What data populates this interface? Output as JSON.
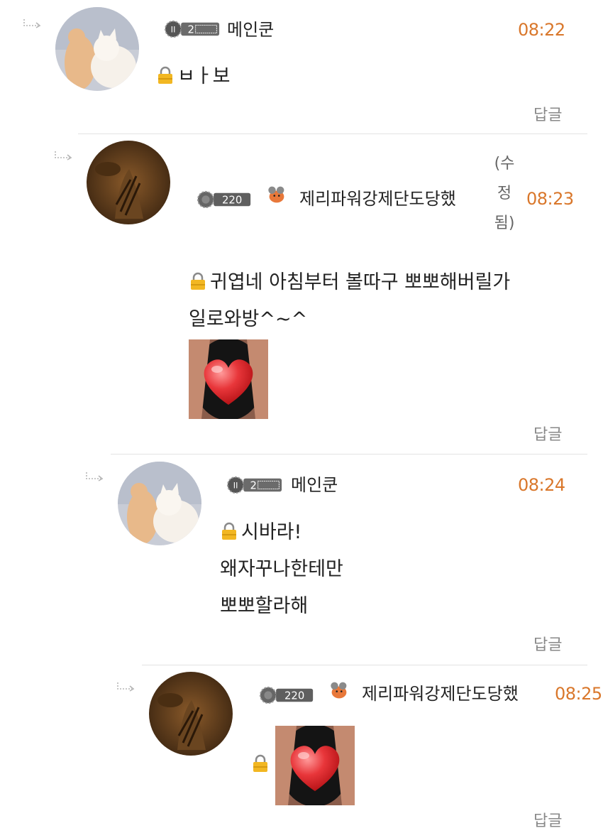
{
  "comments": [
    {
      "author": "메인쿤",
      "time": "08:22",
      "lines": [
        "ㅂㅏ보"
      ],
      "reply_label": "답글",
      "avatar_icon": "cat-photo",
      "badge_icon": "level-badge-icon"
    },
    {
      "author": "제리파워강제단도당했",
      "badge_level": "220",
      "time": "08:23",
      "edited": [
        "(수",
        "정",
        "됨)"
      ],
      "lines": [
        "귀엽네 아침부터 볼따구 뽀뽀해버릴가",
        "일로와방^~^"
      ],
      "sticker_icon": "heart-sticker",
      "reply_label": "답글",
      "avatar_icon": "tabby-cat-photo",
      "badge_icon": "level-badge-icon"
    },
    {
      "author": "메인쿤",
      "time": "08:24",
      "lines": [
        "시바라!",
        "왜자꾸나한테만",
        "뽀뽀할라해"
      ],
      "reply_label": "답글",
      "avatar_icon": "cat-photo",
      "badge_icon": "level-badge-icon"
    },
    {
      "author": "제리파워강제단도당했",
      "badge_level": "220",
      "time": "08:25",
      "lines": [],
      "sticker_icon": "heart-sticker",
      "reply_label": "답글",
      "avatar_icon": "tabby-cat-photo",
      "badge_icon": "level-badge-icon"
    }
  ],
  "colors": {
    "time": "#d9772b",
    "text": "#222222",
    "reply": "#888888",
    "divider": "#e3e3e3"
  }
}
